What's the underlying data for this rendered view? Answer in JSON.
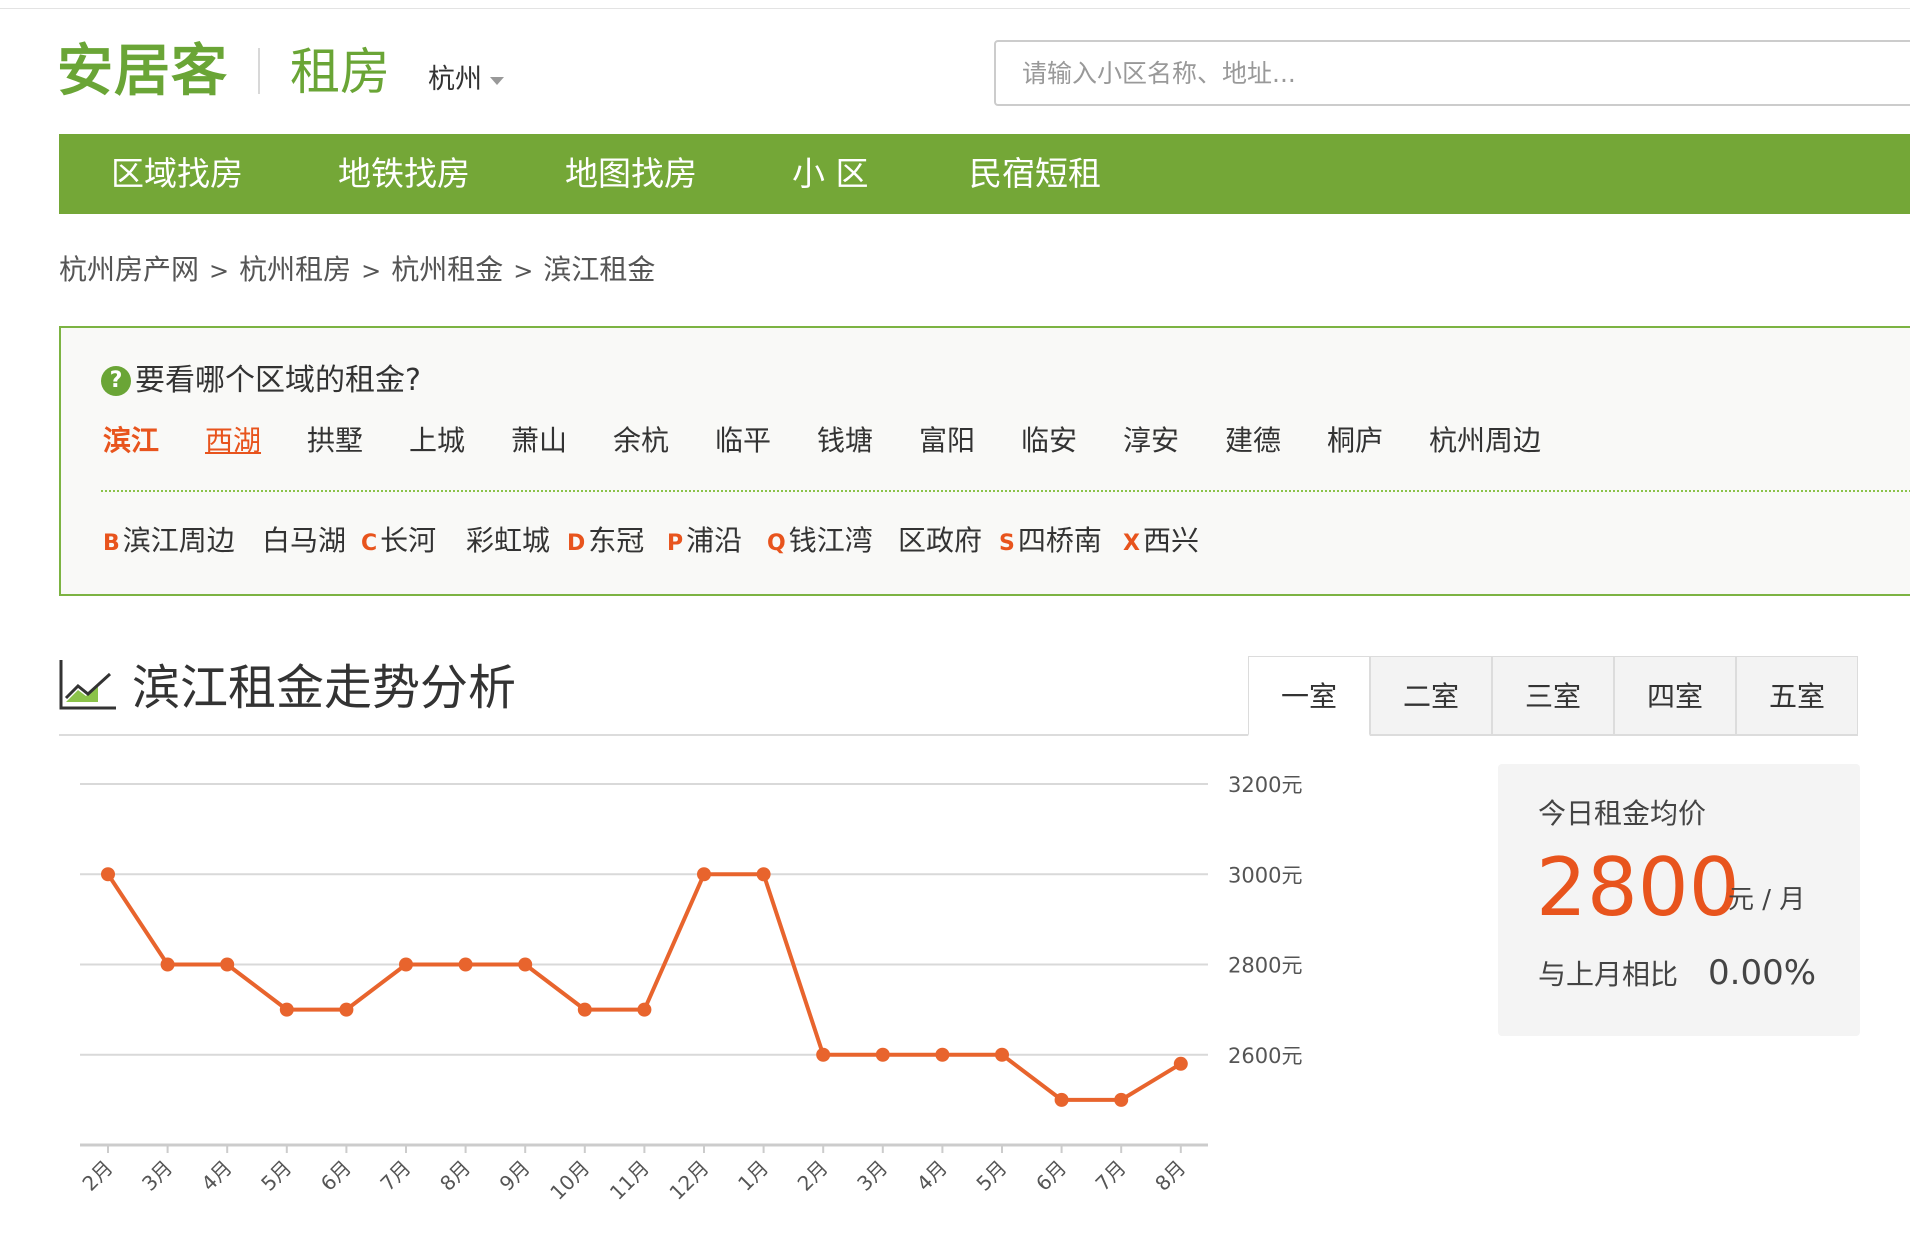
{
  "header": {
    "logo": "安居客",
    "section": "租房",
    "city": "杭州",
    "search_placeholder": "请输入小区名称、地址..."
  },
  "nav": [
    "区域找房",
    "地铁找房",
    "地图找房",
    "小 区",
    "民宿短租"
  ],
  "breadcrumb": [
    "杭州房产网",
    "杭州租房",
    "杭州租金",
    "滨江租金"
  ],
  "region": {
    "question": "要看哪个区域的租金?",
    "districts": [
      "滨江",
      "西湖",
      "拱墅",
      "上城",
      "萧山",
      "余杭",
      "临平",
      "钱塘",
      "富阳",
      "临安",
      "淳安",
      "建德",
      "桐庐",
      "杭州周边"
    ],
    "active_district": "滨江",
    "sub_areas": [
      {
        "letter": "B",
        "name": "滨江周边"
      },
      {
        "letter": "",
        "name": "白马湖"
      },
      {
        "letter": "C",
        "name": "长河"
      },
      {
        "letter": "",
        "name": "彩虹城"
      },
      {
        "letter": "D",
        "name": "东冠"
      },
      {
        "letter": "P",
        "name": "浦沿"
      },
      {
        "letter": "Q",
        "name": "钱江湾"
      },
      {
        "letter": "",
        "name": "区政府"
      },
      {
        "letter": "S",
        "name": "四桥南"
      },
      {
        "letter": "X",
        "name": "西兴"
      }
    ]
  },
  "trend": {
    "title": "滨江租金走势分析",
    "tabs": [
      "一室",
      "二室",
      "三室",
      "四室",
      "五室"
    ],
    "active_tab": "一室"
  },
  "chart_data": {
    "type": "line",
    "categories": [
      "2月",
      "3月",
      "4月",
      "5月",
      "6月",
      "7月",
      "8月",
      "9月",
      "10月",
      "11月",
      "12月",
      "1月",
      "2月",
      "3月",
      "4月",
      "5月",
      "6月",
      "7月",
      "8月"
    ],
    "series": [
      {
        "values": [
          3000,
          2800,
          2800,
          2700,
          2700,
          2800,
          2800,
          2800,
          2700,
          2700,
          3000,
          3000,
          2600,
          2600,
          2600,
          2600,
          2500,
          2500,
          2580
        ]
      }
    ],
    "y_ticks": [
      "3200元",
      "3000元",
      "2800元",
      "2600元"
    ],
    "ylim": [
      2400,
      3200
    ],
    "y_tick_values": [
      3200,
      3000,
      2800,
      2600
    ],
    "grid": true,
    "line_color": "#e8642d",
    "y_axis_position": "right"
  },
  "price_card": {
    "label": "今日租金均价",
    "value": "2800",
    "unit": "元 / 月",
    "compare_label": "与上月相比",
    "change": "0.00%"
  },
  "colors": {
    "brand_green": "#6aa536",
    "nav_green": "#74a737",
    "accent_orange": "#e8541d"
  }
}
